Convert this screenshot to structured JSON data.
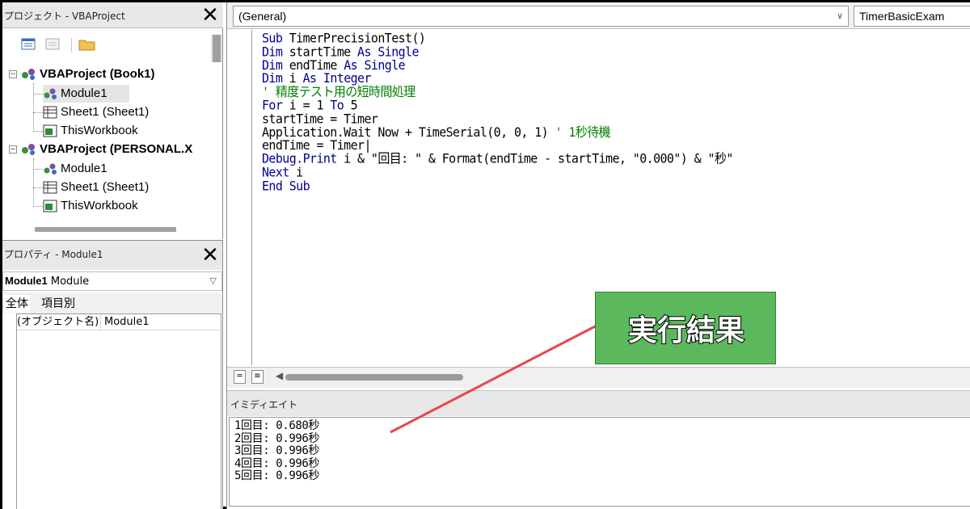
{
  "project_explorer": {
    "title": "プロジェクト - VBAProject",
    "close": "✕",
    "tree": [
      {
        "label": "VBAProject (Book1)",
        "kind": "project"
      },
      {
        "label": "Module1",
        "kind": "module",
        "selected": true
      },
      {
        "label": "Sheet1 (Sheet1)",
        "kind": "sheet"
      },
      {
        "label": "ThisWorkbook",
        "kind": "workbook"
      },
      {
        "label": "VBAProject (PERSONAL.X",
        "kind": "project"
      },
      {
        "label": "Module1",
        "kind": "module"
      },
      {
        "label": "Sheet1 (Sheet1)",
        "kind": "sheet"
      },
      {
        "label": "ThisWorkbook",
        "kind": "workbook"
      }
    ]
  },
  "properties": {
    "title": "プロパティ - Module1",
    "close": "✕",
    "object_name": "Module1",
    "object_type": "Module",
    "tabs": [
      "全体",
      "項目別"
    ],
    "rows": [
      {
        "key": "(オブジェクト名)",
        "value": "Module1"
      }
    ]
  },
  "code_window": {
    "object_combo": "(General)",
    "proc_combo": "TimerBasicExam",
    "lines": [
      [
        [
          "kw",
          "Sub "
        ],
        [
          "tx",
          "TimerPrecisionTest()"
        ]
      ],
      [
        [
          "kw",
          "Dim "
        ],
        [
          "tx",
          "startTime "
        ],
        [
          "kw",
          "As Single"
        ]
      ],
      [
        [
          "kw",
          "Dim "
        ],
        [
          "tx",
          "endTime "
        ],
        [
          "kw",
          "As Single"
        ]
      ],
      [
        [
          "kw",
          "Dim "
        ],
        [
          "tx",
          "i "
        ],
        [
          "kw",
          "As Integer"
        ]
      ],
      [
        [
          "cm",
          "' 精度テスト用の短時間処理"
        ]
      ],
      [
        [
          "kw",
          "For "
        ],
        [
          "tx",
          "i = 1 "
        ],
        [
          "kw",
          "To "
        ],
        [
          "tx",
          "5"
        ]
      ],
      [
        [
          "tx",
          "startTime = Timer"
        ]
      ],
      [
        [
          "tx",
          "Application.Wait Now + TimeSerial(0, 0, 1) "
        ],
        [
          "cm",
          "' 1秒待機"
        ]
      ],
      [
        [
          "tx",
          "endTime = Timer|"
        ]
      ],
      [
        [
          "kw",
          "Debug.Print "
        ],
        [
          "tx",
          "i & \"回目: \" & Format(endTime - startTime, \"0.000\") & \"秒\""
        ]
      ],
      [
        [
          "kw",
          "Next "
        ],
        [
          "tx",
          "i"
        ]
      ],
      [
        [
          "kw",
          "End Sub"
        ]
      ]
    ]
  },
  "immediate": {
    "title": "イミディエイト",
    "output": [
      "1回目: 0.680秒",
      "2回目: 0.996秒",
      "3回目: 0.996秒",
      "4回目: 0.996秒",
      "5回目: 0.996秒"
    ]
  },
  "callout": {
    "text": "実行結果",
    "color": "#5cb85c",
    "arrow_color": "#e8474b"
  }
}
